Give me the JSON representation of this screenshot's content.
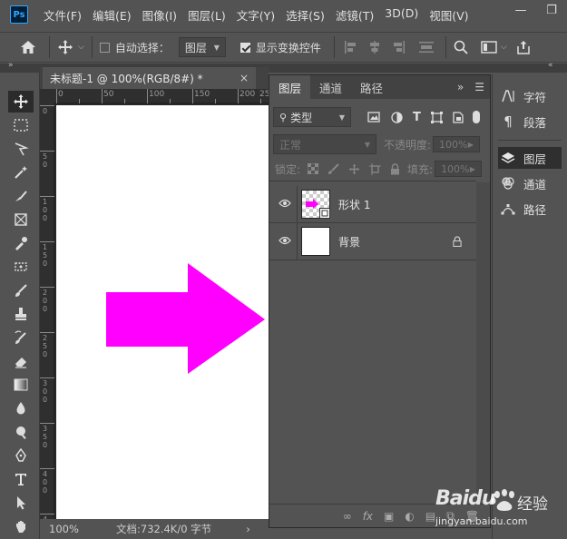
{
  "menu": {
    "logo": "Ps",
    "items": [
      "文件(F)",
      "编辑(E)",
      "图像(I)",
      "图层(L)",
      "文字(Y)",
      "选择(S)",
      "滤镜(T)",
      "3D(D)",
      "视图(V)"
    ],
    "minimize": "—",
    "restore": "❐"
  },
  "options": {
    "auto_select_label": "自动选择：",
    "auto_select_target": "图层",
    "show_transform_label": "显示变换控件"
  },
  "document": {
    "tab_title": "未标题-1 @ 100%(RGB/8#) *",
    "close": "×",
    "ruler_h": [
      "0",
      "50",
      "100",
      "150",
      "200",
      "25"
    ],
    "ruler_v": [
      "0",
      "5",
      "0",
      "1",
      "0",
      "0",
      "1",
      "5",
      "0",
      "2",
      "0",
      "0",
      "2",
      "5",
      "0",
      "3",
      "0",
      "0",
      "3",
      "5",
      "0",
      "4",
      "0",
      "0",
      "4",
      "5",
      "0"
    ],
    "shape_color": "#ff00ff"
  },
  "status": {
    "zoom": "100%",
    "doc_info": "文档:732.4K/0 字节",
    "arrow": "›"
  },
  "layers_panel": {
    "tabs": [
      "图层",
      "通道",
      "路径"
    ],
    "filter_kind": "类型",
    "blend_mode": "正常",
    "opacity_label": "不透明度:",
    "opacity_value": "100%",
    "lock_label": "锁定:",
    "fill_label": "填充:",
    "fill_value": "100%",
    "layers": [
      {
        "name": "形状 1",
        "type": "shape"
      },
      {
        "name": "背景",
        "type": "background",
        "locked": true
      }
    ]
  },
  "right_dock": {
    "items": [
      "字符",
      "段落",
      "图层",
      "通道",
      "路径"
    ]
  },
  "watermark": {
    "brand": "Baidu",
    "cn": "经验",
    "url": "jingyan.baidu.com"
  }
}
